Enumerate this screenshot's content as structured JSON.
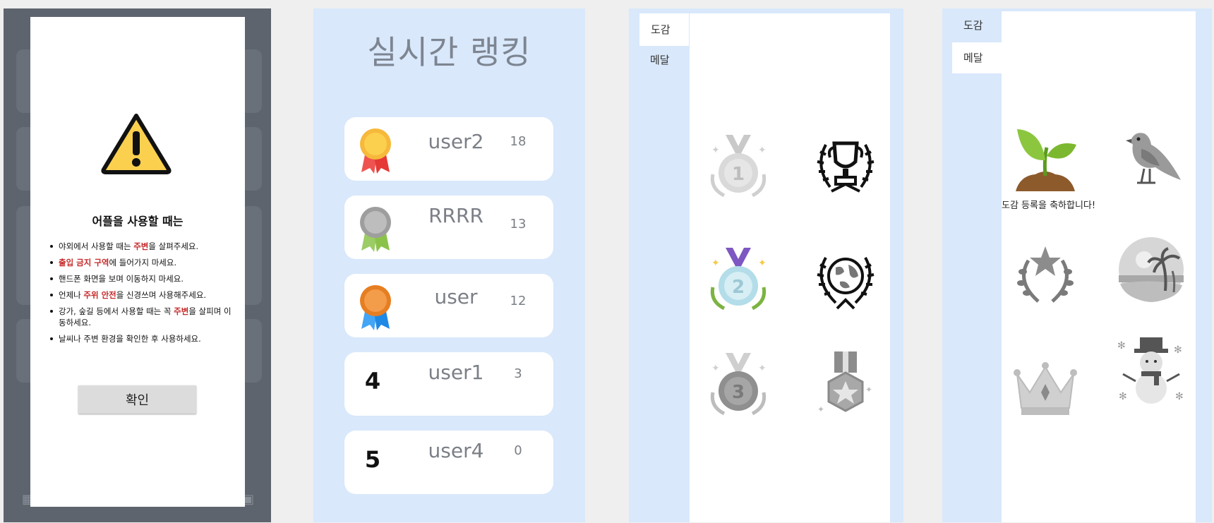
{
  "dialog": {
    "title": "어플을 사용할 때는",
    "rules": [
      {
        "parts": [
          {
            "t": "야외에서 사용할 때는 ",
            "hl": false
          },
          {
            "t": "주변",
            "hl": true
          },
          {
            "t": "을 살펴주세요.",
            "hl": false
          }
        ]
      },
      {
        "parts": [
          {
            "t": "출입 금지 구역",
            "hl": true
          },
          {
            "t": "에 들어가지 마세요.",
            "hl": false
          }
        ]
      },
      {
        "parts": [
          {
            "t": "핸드폰 화면을 보며 이동하지 마세요.",
            "hl": false
          }
        ]
      },
      {
        "parts": [
          {
            "t": "언제나 ",
            "hl": false
          },
          {
            "t": "주위 안전",
            "hl": true
          },
          {
            "t": "을 신경쓰며 사용해주세요.",
            "hl": false
          }
        ]
      },
      {
        "parts": [
          {
            "t": "강가, 숲길 등에서 사용할 때는 꼭 ",
            "hl": false
          },
          {
            "t": "주변",
            "hl": true
          },
          {
            "t": "을 살피며 이동하세요.",
            "hl": false
          }
        ]
      },
      {
        "parts": [
          {
            "t": "날씨나 주변 환경을 확인한 후 사용하세요.",
            "hl": false
          }
        ]
      }
    ],
    "confirm_label": "확인",
    "icon": "warning-triangle-icon"
  },
  "ranking": {
    "title": "실시간 랭킹",
    "entries": [
      {
        "rank": "1",
        "name": "user2",
        "score": "18",
        "badge": "gold-medal-ribbon"
      },
      {
        "rank": "2",
        "name": "RRRR",
        "score": "13",
        "badge": "silver-medal-ribbon"
      },
      {
        "rank": "3",
        "name": "user",
        "score": "12",
        "badge": "bronze-medal-ribbon"
      },
      {
        "rank": "4",
        "name": "user1",
        "score": "3",
        "badge": ""
      },
      {
        "rank": "5",
        "name": "user4",
        "score": "0",
        "badge": ""
      }
    ]
  },
  "collection_medals": {
    "tabs": [
      "도감",
      "메달"
    ],
    "active_tab": "메달",
    "icons": [
      "medal-1st-locked-icon",
      "trophy-laurel-icon",
      "medal-2nd-icon",
      "globe-laurel-icon",
      "medal-3rd-locked-icon",
      "star-hexagon-medal-locked-icon"
    ]
  },
  "collection_dex": {
    "tabs": [
      "도감",
      "메달"
    ],
    "active_tab": "도감",
    "congrats": "도감 등록을 축하합니다!",
    "icons": [
      "sprout-icon",
      "bird-locked-icon",
      "star-laurel-locked-icon",
      "beach-palm-locked-icon",
      "crown-locked-icon",
      "snowman-locked-icon"
    ]
  },
  "colors": {
    "accent_bg": "#d9e8fb",
    "highlight_text": "#c62828",
    "gold": "#f6b93b",
    "silver": "#bdbdbd",
    "bronze": "#e67e22"
  }
}
